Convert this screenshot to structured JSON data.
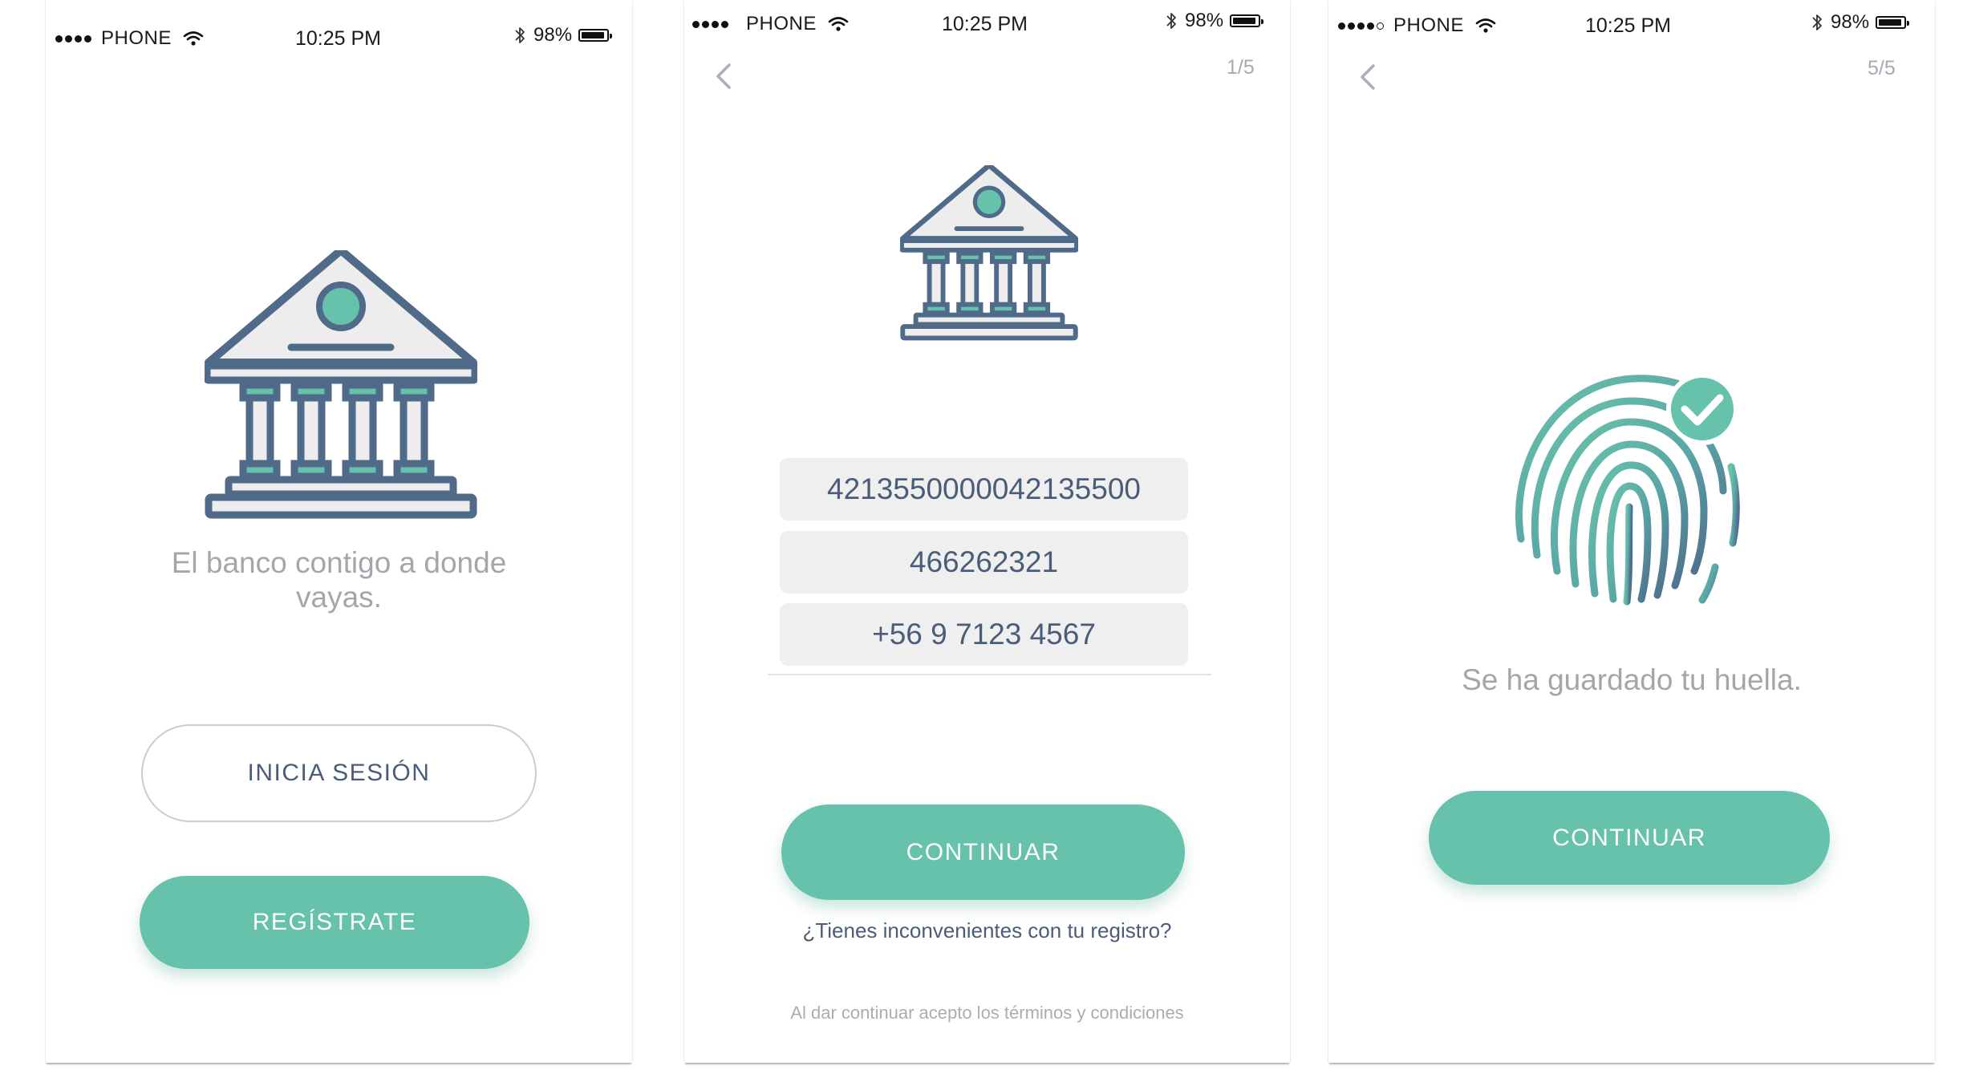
{
  "status_bar": {
    "carrier": "PHONE",
    "time": "10:25 PM",
    "battery": "98%"
  },
  "screen_welcome": {
    "tagline_line1": "El banco contigo a donde",
    "tagline_line2": "vayas.",
    "login_label": "INICIA SESIÓN",
    "register_label": "REGÍSTRATE"
  },
  "screen_register": {
    "step": "1/5",
    "card_number": "4213550000042135500",
    "document_number": "466262321",
    "phone_number": "+56 9 7123 4567",
    "continue_label": "CONTINUAR",
    "help_link": "¿Tienes inconvenientes con tu registro?",
    "terms": "Al dar continuar acepto los términos y condiciones"
  },
  "screen_fingerprint": {
    "step": "5/5",
    "message": "Se ha guardado tu huella.",
    "continue_label": "CONTINUAR"
  },
  "colors": {
    "accent": "#66c2ab",
    "navy": "#506a8a",
    "text_gray": "#a3a7ab"
  }
}
